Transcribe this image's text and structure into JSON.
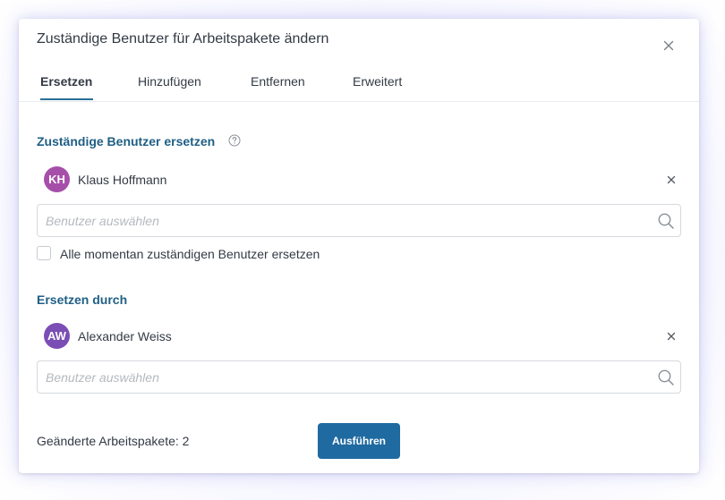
{
  "dialog": {
    "title": "Zuständige Benutzer für Arbeitspakete ändern"
  },
  "tabs": [
    {
      "label": "Ersetzen",
      "active": true
    },
    {
      "label": "Hinzufügen",
      "active": false
    },
    {
      "label": "Entfernen",
      "active": false
    },
    {
      "label": "Erweitert",
      "active": false
    }
  ],
  "replace_section": {
    "title": "Zuständige Benutzer ersetzen",
    "user": {
      "initials": "KH",
      "name": "Klaus Hoffmann",
      "avatar_color": "#a64fa9"
    },
    "select_placeholder": "Benutzer auswählen",
    "checkbox_label": "Alle momentan zuständigen Benutzer ersetzen",
    "checkbox_checked": false
  },
  "replace_with_section": {
    "title": "Ersetzen durch",
    "user": {
      "initials": "AW",
      "name": "Alexander Weiss",
      "avatar_color": "#7a4eb4"
    },
    "select_placeholder": "Benutzer auswählen"
  },
  "footer": {
    "changed_count_label": "Geänderte Arbeitspakete: 2",
    "execute_label": "Ausführen"
  },
  "colors": {
    "accent": "#1f6aa0",
    "section_title": "#1f5f85"
  }
}
